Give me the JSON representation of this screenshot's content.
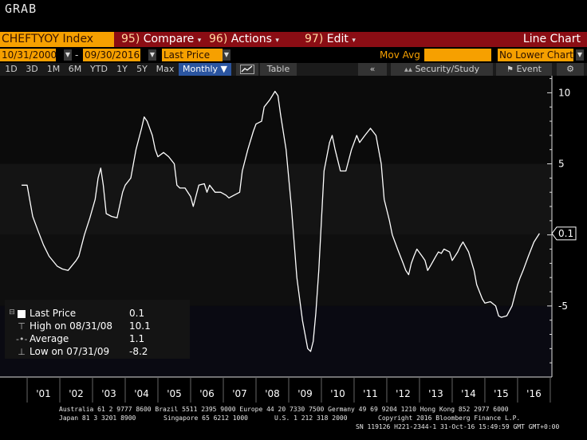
{
  "top_label": "GRAB",
  "menu": {
    "ticker": "CHEFTYOY Index",
    "compare_num": "95)",
    "compare": "Compare",
    "actions_num": "96)",
    "actions": "Actions",
    "edit_num": "97)",
    "edit": "Edit",
    "chart_type": "Line Chart"
  },
  "daterow": {
    "start": "10/31/2000",
    "end": "09/30/2016",
    "field": "Last Price",
    "mavg": "Mov Avg",
    "lower": "No Lower Chart"
  },
  "toolbar": {
    "ranges": [
      "1D",
      "3D",
      "1M",
      "6M",
      "YTD",
      "1Y",
      "5Y",
      "Max"
    ],
    "period": "Monthly ▼",
    "table": "Table",
    "security": "Security/Study",
    "event": "Event"
  },
  "legend": {
    "last_label": "Last Price",
    "last_value": "0.1",
    "high_label": "High on 08/31/08",
    "high_value": "10.1",
    "avg_label": "Average",
    "avg_value": "1.1",
    "low_label": "Low on 07/31/09",
    "low_value": "-8.2"
  },
  "footer": {
    "line1": "Australia 61 2 9777 8600 Brazil 5511 2395 9000 Europe 44 20 7330 7500 Germany 49 69 9204 1210 Hong Kong 852 2977 6000",
    "line2a": "Japan 81 3 3201 8900",
    "line2b": "Singapore 65 6212 1000",
    "line2c": "U.S. 1 212 318 2000",
    "line2d": "Copyright 2016 Bloomberg Finance L.P.",
    "line3": "SN 119126 H221-2344-1 31-Oct-16 15:49:59 GMT  GMT+0:00"
  },
  "colors": {
    "line": "#ffffff",
    "menu_bar": "#8b0d14",
    "accent": "#f6a000",
    "background": "#000000"
  },
  "chart_data": {
    "type": "line",
    "x_ticks": [
      "'01",
      "'02",
      "'03",
      "'04",
      "'05",
      "'06",
      "'07",
      "'08",
      "'09",
      "'10",
      "'11",
      "'12",
      "'13",
      "'14",
      "'15",
      "'16"
    ],
    "y_ticks": [
      10,
      5,
      -5
    ],
    "ylim": [
      -10,
      11.2
    ],
    "last_value_label": "0.1",
    "series": [
      {
        "points": [
          [
            2000.83,
            3.5
          ],
          [
            2001.0,
            3.5
          ],
          [
            2001.17,
            1.3
          ],
          [
            2001.33,
            0.3
          ],
          [
            2001.5,
            -0.7
          ],
          [
            2001.67,
            -1.5
          ],
          [
            2001.92,
            -2.2
          ],
          [
            2002.08,
            -2.4
          ],
          [
            2002.25,
            -2.5
          ],
          [
            2002.5,
            -1.8
          ],
          [
            2002.58,
            -1.5
          ],
          [
            2002.75,
            0.0
          ],
          [
            2002.92,
            1.2
          ],
          [
            2003.08,
            2.5
          ],
          [
            2003.17,
            4.0
          ],
          [
            2003.25,
            4.7
          ],
          [
            2003.33,
            3.5
          ],
          [
            2003.42,
            1.5
          ],
          [
            2003.58,
            1.3
          ],
          [
            2003.75,
            1.2
          ],
          [
            2003.92,
            3.0
          ],
          [
            2004.0,
            3.5
          ],
          [
            2004.17,
            4.0
          ],
          [
            2004.33,
            6.0
          ],
          [
            2004.5,
            7.5
          ],
          [
            2004.58,
            8.3
          ],
          [
            2004.67,
            8.0
          ],
          [
            2004.83,
            7.0
          ],
          [
            2004.92,
            6.0
          ],
          [
            2005.0,
            5.5
          ],
          [
            2005.17,
            5.8
          ],
          [
            2005.33,
            5.5
          ],
          [
            2005.5,
            5.0
          ],
          [
            2005.58,
            3.5
          ],
          [
            2005.67,
            3.3
          ],
          [
            2005.83,
            3.3
          ],
          [
            2006.0,
            2.7
          ],
          [
            2006.08,
            2.0
          ],
          [
            2006.25,
            3.5
          ],
          [
            2006.42,
            3.6
          ],
          [
            2006.5,
            3.0
          ],
          [
            2006.58,
            3.5
          ],
          [
            2006.75,
            3.0
          ],
          [
            2006.92,
            3.0
          ],
          [
            2007.08,
            2.8
          ],
          [
            2007.17,
            2.6
          ],
          [
            2007.33,
            2.8
          ],
          [
            2007.5,
            3.0
          ],
          [
            2007.58,
            4.5
          ],
          [
            2007.75,
            6.0
          ],
          [
            2007.92,
            7.3
          ],
          [
            2008.0,
            7.8
          ],
          [
            2008.17,
            8.0
          ],
          [
            2008.25,
            9.0
          ],
          [
            2008.42,
            9.5
          ],
          [
            2008.58,
            10.1
          ],
          [
            2008.67,
            9.8
          ],
          [
            2008.75,
            8.5
          ],
          [
            2008.92,
            6.0
          ],
          [
            2009.08,
            2.0
          ],
          [
            2009.25,
            -3.0
          ],
          [
            2009.42,
            -6.0
          ],
          [
            2009.58,
            -8.0
          ],
          [
            2009.67,
            -8.2
          ],
          [
            2009.75,
            -7.5
          ],
          [
            2009.83,
            -5.5
          ],
          [
            2009.92,
            -2.5
          ],
          [
            2010.0,
            1.0
          ],
          [
            2010.08,
            4.5
          ],
          [
            2010.25,
            6.5
          ],
          [
            2010.33,
            7.0
          ],
          [
            2010.42,
            6.0
          ],
          [
            2010.58,
            4.5
          ],
          [
            2010.75,
            4.5
          ],
          [
            2010.92,
            6.0
          ],
          [
            2011.08,
            7.0
          ],
          [
            2011.17,
            6.5
          ],
          [
            2011.33,
            7.0
          ],
          [
            2011.5,
            7.5
          ],
          [
            2011.67,
            7.0
          ],
          [
            2011.83,
            5.0
          ],
          [
            2011.92,
            2.5
          ],
          [
            2012.08,
            1.0
          ],
          [
            2012.17,
            0.0
          ],
          [
            2012.33,
            -1.0
          ],
          [
            2012.5,
            -2.0
          ],
          [
            2012.58,
            -2.5
          ],
          [
            2012.67,
            -2.8
          ],
          [
            2012.75,
            -2.0
          ],
          [
            2012.83,
            -1.5
          ],
          [
            2012.92,
            -1.0
          ],
          [
            2013.08,
            -1.5
          ],
          [
            2013.17,
            -1.8
          ],
          [
            2013.25,
            -2.5
          ],
          [
            2013.33,
            -2.2
          ],
          [
            2013.5,
            -1.5
          ],
          [
            2013.58,
            -1.2
          ],
          [
            2013.67,
            -1.3
          ],
          [
            2013.75,
            -1.0
          ],
          [
            2013.92,
            -1.2
          ],
          [
            2014.0,
            -1.8
          ],
          [
            2014.17,
            -1.2
          ],
          [
            2014.25,
            -0.8
          ],
          [
            2014.33,
            -0.5
          ],
          [
            2014.5,
            -1.2
          ],
          [
            2014.67,
            -2.5
          ],
          [
            2014.75,
            -3.5
          ],
          [
            2014.92,
            -4.5
          ],
          [
            2015.0,
            -4.8
          ],
          [
            2015.17,
            -4.7
          ],
          [
            2015.33,
            -5.0
          ],
          [
            2015.42,
            -5.7
          ],
          [
            2015.5,
            -5.8
          ],
          [
            2015.67,
            -5.7
          ],
          [
            2015.83,
            -5.0
          ],
          [
            2015.92,
            -4.2
          ],
          [
            2016.0,
            -3.5
          ],
          [
            2016.08,
            -3.0
          ],
          [
            2016.17,
            -2.5
          ],
          [
            2016.33,
            -1.5
          ],
          [
            2016.5,
            -0.5
          ],
          [
            2016.67,
            0.1
          ]
        ]
      }
    ]
  }
}
